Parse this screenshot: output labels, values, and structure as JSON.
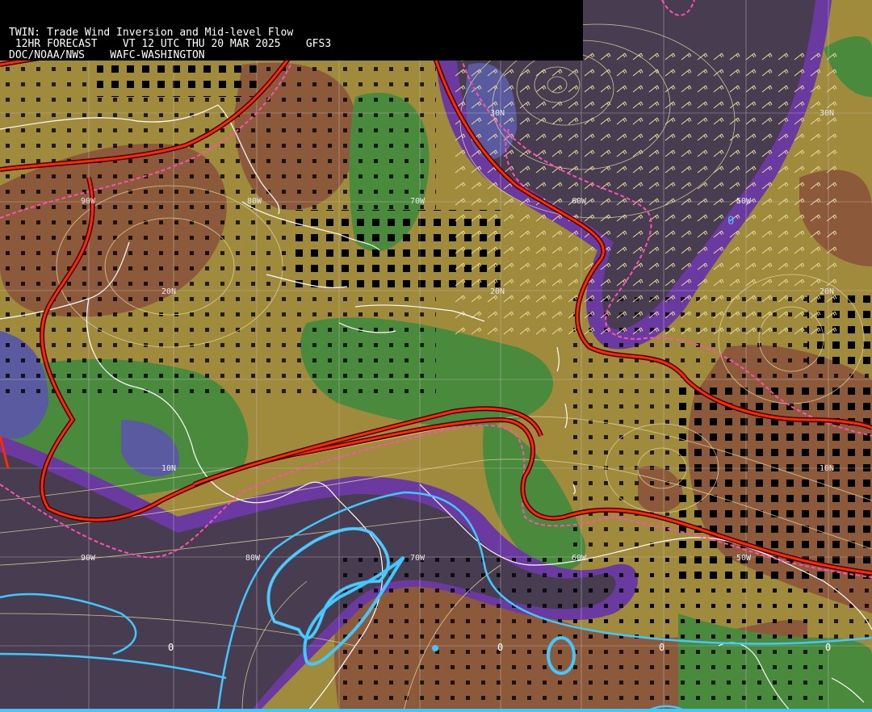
{
  "header": {
    "line1": "TWIN: Trade Wind Inversion and Mid-level Flow",
    "line2": " 12HR FORECAST    VT 12 UTC THU 20 MAR 2025    GFS3",
    "line3": "DOC/NOAA/NWS    WAFC-WASHINGTON"
  },
  "grid_labels": {
    "lon_row_upper": [
      "90W",
      "80W",
      "70W",
      "60W",
      "50W"
    ],
    "lon_row_lower": [
      "90W",
      "80W",
      "70W",
      "60W",
      "50W"
    ],
    "lat_30": [
      "30N",
      "30N"
    ],
    "lat_20": [
      "20N",
      "20N",
      "20N"
    ],
    "lat_10": [
      "10N",
      "10N"
    ],
    "zero_marks": [
      "0",
      "0",
      "0",
      "0"
    ],
    "cyan_zero": "0"
  },
  "colors": {
    "ocean_dark": "#483c50",
    "olive": "#a08a3c",
    "brown": "#8c5a3a",
    "green": "#4a8a3c",
    "purple": "#6a3aa0",
    "blue_violet": "#5a5aa0",
    "red_contour": "#ff2a00",
    "pink_dashed": "#ff50b0",
    "cyan_contour": "#40c8ff",
    "coast": "#ffffff",
    "grid": "#c8c8c8",
    "streamline": "#e6dca0"
  }
}
